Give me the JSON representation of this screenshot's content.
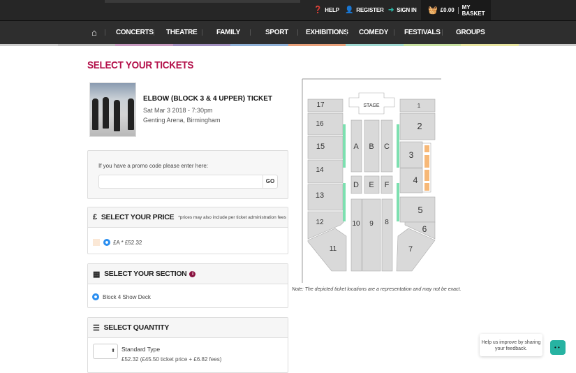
{
  "utility": {
    "help": "HELP",
    "register": "REGISTER",
    "sign_in": "SIGN IN",
    "basket_total": "£0.00",
    "my_basket": "MY BASKET"
  },
  "nav": {
    "items": [
      "CONCERTS",
      "THEATRE",
      "FAMILY",
      "SPORT",
      "EXHIBITIONS",
      "COMEDY",
      "FESTIVALS",
      "GROUPS"
    ]
  },
  "page_title": "SELECT YOUR TICKETS",
  "event": {
    "title": "ELBOW (BLOCK 3 & 4 UPPER) TICKET",
    "date": "Sat Mar 3 2018 - 7:30pm",
    "venue": "Genting Arena, Birmingham"
  },
  "promo": {
    "label": "If you have a promo code please enter here:",
    "value": "",
    "go": "GO"
  },
  "price": {
    "icon": "£",
    "title": "SELECT YOUR PRICE",
    "note": "*prices may also include per ticket administration fees",
    "option": "£A * £52.32"
  },
  "section": {
    "title": "SELECT YOUR SECTION",
    "option": "Block 4 Show Deck"
  },
  "quantity": {
    "title": "SELECT QUANTITY",
    "type": "Standard Type",
    "price": "£52.32 (£45.50 ticket price + £6.82 fees)"
  },
  "map": {
    "stage": "STAGE",
    "blocks": [
      "1",
      "2",
      "3",
      "4",
      "5",
      "6",
      "7",
      "8",
      "9",
      "10",
      "11",
      "12",
      "13",
      "14",
      "15",
      "16",
      "17",
      "A",
      "B",
      "C",
      "D",
      "E",
      "F"
    ],
    "note": "Note: The depicted ticket locations are a representation and may not be exact."
  },
  "feedback": {
    "text": "Help us improve by sharing your feedback."
  },
  "colors": {
    "accent": "#b3104a",
    "teal": "#2bb3a3",
    "highlight": "#f7b877",
    "walkway": "#7de0b0"
  }
}
